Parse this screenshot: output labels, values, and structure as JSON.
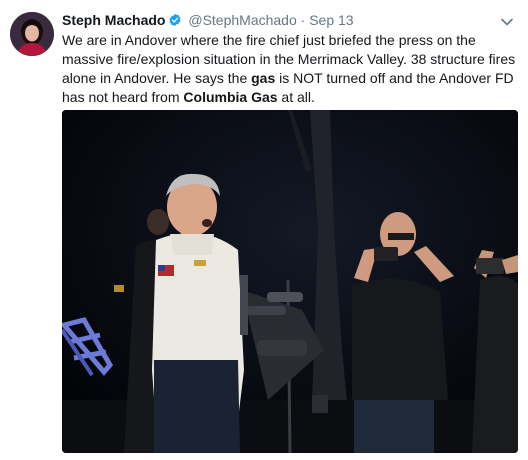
{
  "tweet": {
    "author_name": "Steph Machado",
    "handle": "@StephMachado",
    "separator": "·",
    "date": "Sep 13",
    "text_parts": {
      "p1": "We are in Andover where the fire chief just briefed the press on the massive fire/explosion situation in the Merrimack Valley. 38 structure fires alone in Andover. He says the ",
      "p2": "gas",
      "p3": " is NOT turned off and the Andover FD has not heard from ",
      "p4": "Columbia Gas",
      "p5": " at all."
    }
  },
  "icons": {
    "verified": "verified-badge-icon",
    "menu": "chevron-down-icon"
  },
  "colors": {
    "text": "#14171a",
    "muted": "#657786",
    "verified": "#1da1f2",
    "photo_background": "#05060a"
  }
}
